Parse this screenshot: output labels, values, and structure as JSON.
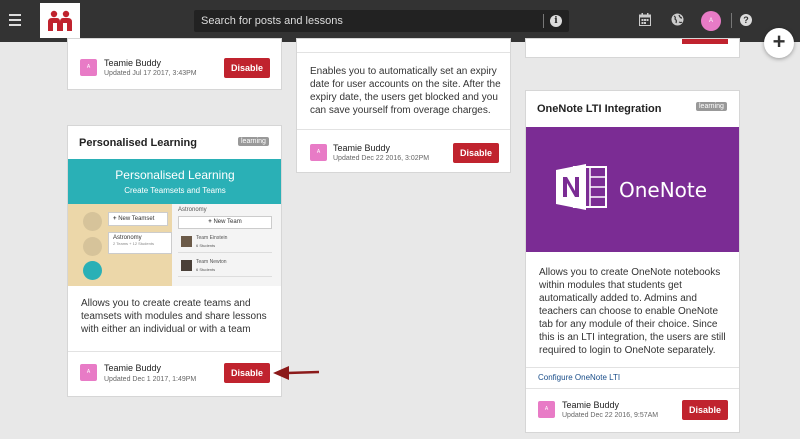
{
  "header": {
    "search_placeholder": "Search for posts and lessons",
    "avatar_initial": "A"
  },
  "cards": {
    "top_left": {
      "author": "Teamie Buddy",
      "updated": "Updated Jul 17 2017, 3:43PM",
      "avatar_initial": "A",
      "action": "Disable"
    },
    "expiry": {
      "description": "Enables you to automatically set an expiry date for user accounts on the site. After the expiry date, the users get blocked and you can save yourself from overage charges.",
      "author": "Teamie Buddy",
      "updated": "Updated Dec 22 2016, 3:02PM",
      "avatar_initial": "A",
      "action": "Disable"
    },
    "personalised": {
      "title": "Personalised Learning",
      "badge": "learning",
      "hero": {
        "title": "Personalised Learning",
        "subtitle": "Create Teamsets and Teams",
        "new_teamset": "New Teamset",
        "new_team": "New Team",
        "astronomy_left": "Astronomy",
        "astronomy_left_sub": "2 Teams + 12 Students",
        "astronomy_right": "Astronomy",
        "team1": "Team Einstein",
        "team1_sub": "6 Students",
        "team2": "Team Newton",
        "team2_sub": "6 Students"
      },
      "description": "Allows you to create create teams and teamsets with modules and share lessons with either an individual or with a team",
      "author": "Teamie Buddy",
      "updated": "Updated Dec 1 2017, 1:49PM",
      "avatar_initial": "A",
      "action": "Disable"
    },
    "onenote": {
      "title": "OneNote LTI Integration",
      "badge": "learning",
      "hero_text": "OneNote",
      "description": "Allows you to create OneNote notebooks within modules that students get automatically added to. Admins and teachers can choose to enable OneNote tab for any module of their choice. Since this is an LTI integration, the users are still required to login to OneNote separately.",
      "configure_link": "Configure OneNote LTI",
      "author": "Teamie Buddy",
      "updated": "Updated Dec 22 2016, 9:57AM",
      "avatar_initial": "A",
      "action": "Disable"
    }
  },
  "colors": {
    "topbar": "#333333",
    "disable": "#c0232e",
    "avatar": "#e87bc6",
    "teal": "#2ab0b6",
    "onenote": "#7b2c94",
    "arrow": "#8b1a1a"
  },
  "icons": [
    "menu-icon",
    "teamie-logo",
    "info-icon",
    "calendar-icon",
    "globe-icon",
    "help-icon",
    "plus-icon",
    "arrow-icon"
  ]
}
